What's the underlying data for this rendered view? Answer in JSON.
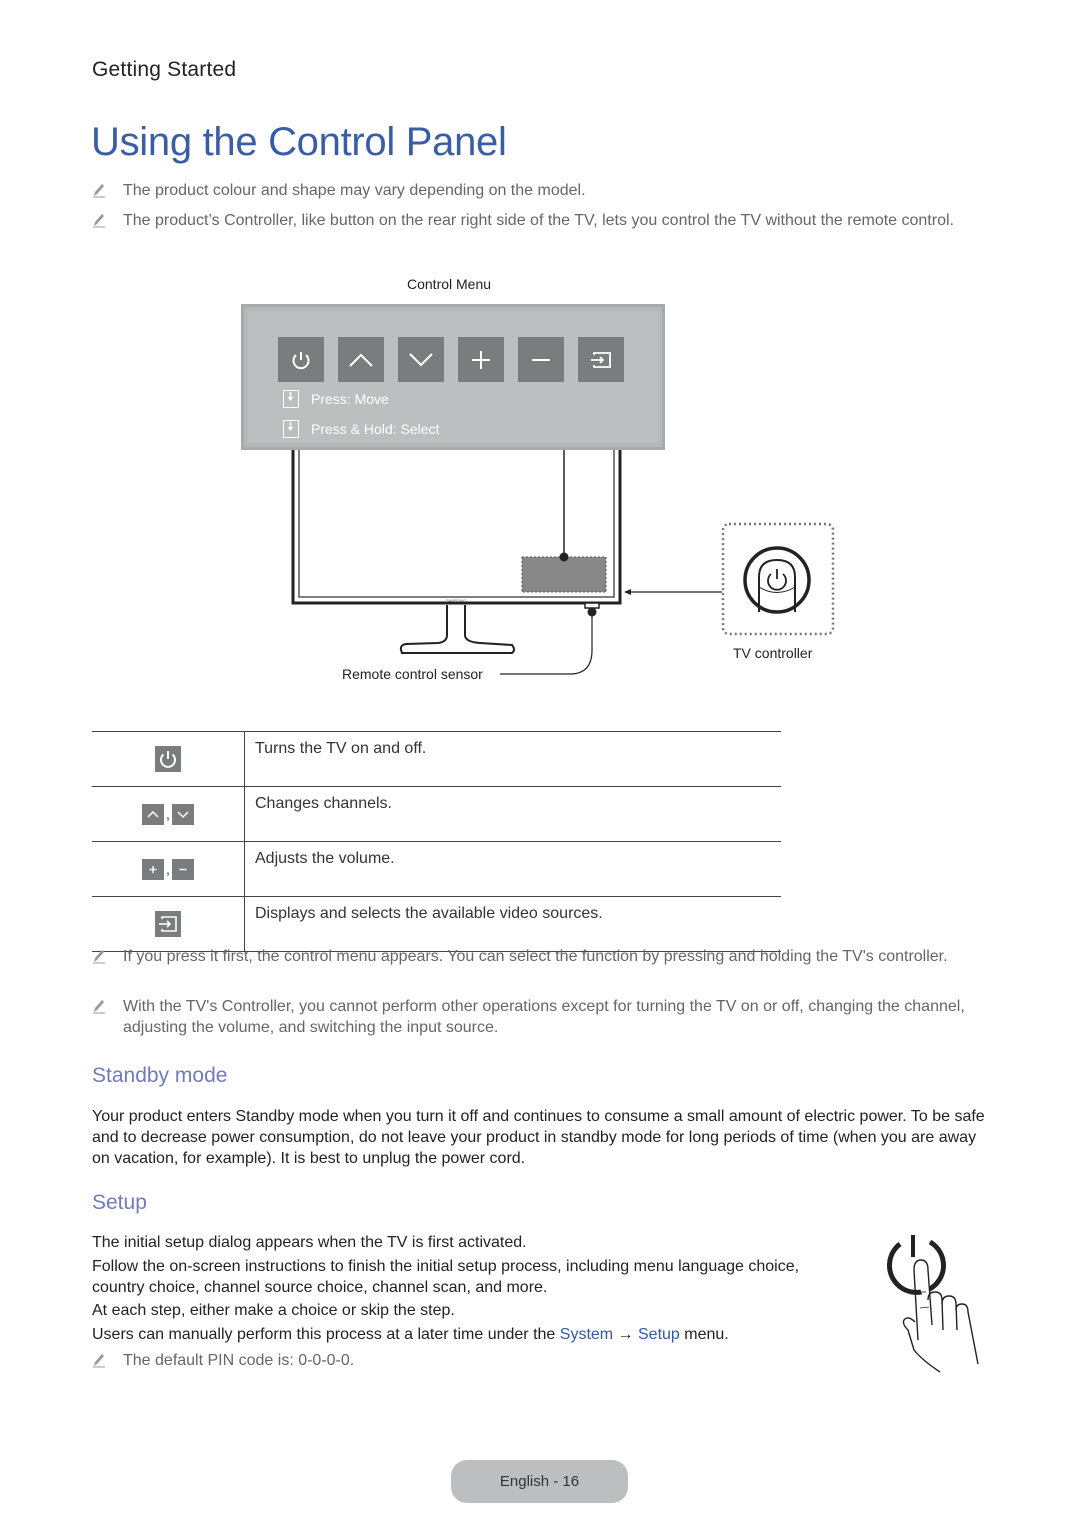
{
  "header": {
    "section": "Getting Started",
    "title": "Using the Control Panel"
  },
  "intro_notes": [
    "The product colour and shape may vary depending on the model.",
    "The product’s Controller, like button on the rear right side of the TV, lets you control the TV without the remote control."
  ],
  "diagram": {
    "control_menu_label": "Control Menu",
    "buttons": [
      "power-icon",
      "chevron-up-icon",
      "chevron-down-icon",
      "plus-icon",
      "minus-icon",
      "source-input-icon"
    ],
    "hint_move": "Press: Move",
    "hint_select": "Press & Hold: Select",
    "remote_sensor_label": "Remote control sensor",
    "tv_controller_label": "TV controller",
    "brand_mark": "SAMSUNG"
  },
  "function_table": {
    "rows": [
      {
        "icons": [
          "power-icon"
        ],
        "description": "Turns the TV on and off."
      },
      {
        "icons": [
          "chevron-up-icon",
          "chevron-down-icon"
        ],
        "separator": ",",
        "description": "Changes channels."
      },
      {
        "icons": [
          "plus-icon",
          "minus-icon"
        ],
        "separator": ",",
        "description": "Adjusts the volume."
      },
      {
        "icons": [
          "source-input-icon"
        ],
        "description": "Displays and selects the available video sources."
      }
    ]
  },
  "after_notes": [
    "If you press it first, the control menu appears. You can select the function by pressing and holding the TV's controller.",
    "With the TV's Controller, you cannot perform other operations except for turning the TV on or off, changing the channel, adjusting the volume, and switching the input source."
  ],
  "standby": {
    "heading": "Standby mode",
    "body": "Your product enters Standby mode when you turn it off and continues to consume a small amount of electric power. To be safe and to decrease power consumption, do not leave your product in standby mode for long periods of time (when you are away on vacation, for example). It is best to unplug the power cord."
  },
  "setup": {
    "heading": "Setup",
    "line1": "The initial setup dialog appears when the TV is first activated.",
    "line2": "Follow the on-screen instructions to finish the initial setup process, including menu language choice, country choice, channel source choice, channel scan, and more.",
    "line3": "At each step, either make a choice or skip the step.",
    "line4_prefix": "Users can manually perform this process at a later time under the ",
    "line4_link1": "System",
    "line4_arrow": " → ",
    "line4_link2": "Setup",
    "line4_suffix": " menu.",
    "pin_note": "The default PIN code is: 0-0-0-0."
  },
  "colors": {
    "title_blue": "#3a5ea6",
    "heading_purple": "#6f7bbd",
    "link_blue": "#2f5aa8",
    "panel_gray": "#bdbec0",
    "button_gray": "#7b7c7e"
  },
  "footer": {
    "page_label": "English - 16"
  }
}
